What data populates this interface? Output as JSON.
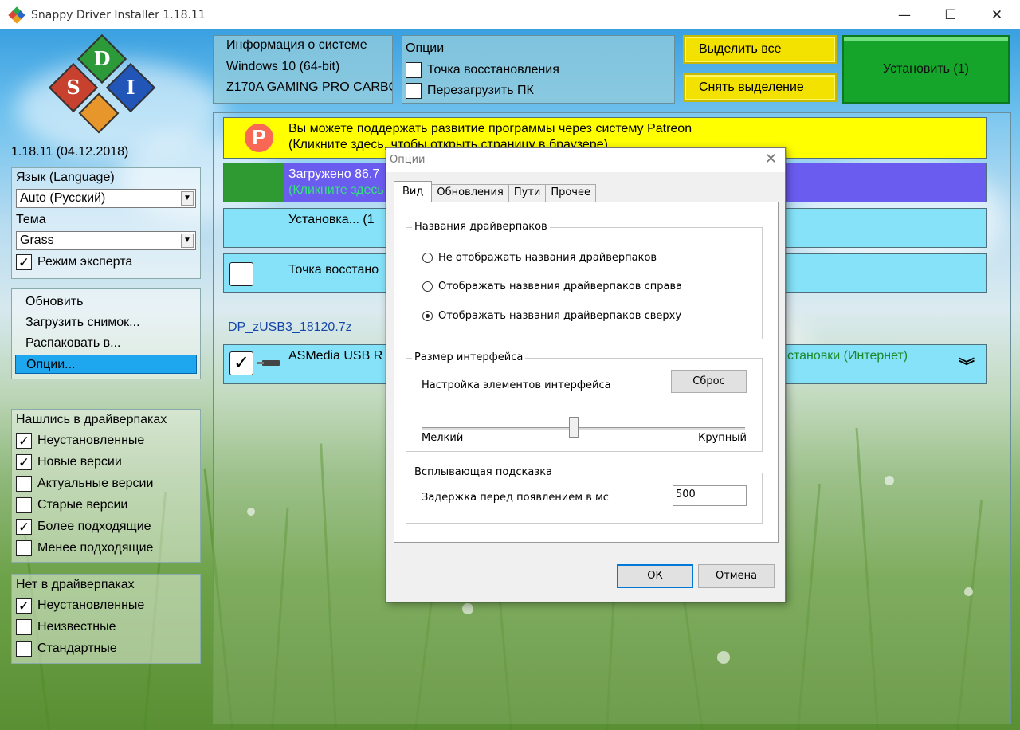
{
  "window": {
    "title": "Snappy Driver Installer 1.18.11",
    "controls": {
      "minimize": "—",
      "maximize": "☐",
      "close": "✕"
    }
  },
  "sidebar": {
    "version": "1.18.11 (04.12.2018)",
    "language_label": "Язык (Language)",
    "language_value": "Auto (Русский)",
    "theme_label": "Тема",
    "theme_value": "Grass",
    "expert_mode": {
      "label": "Режим эксперта",
      "checked": true
    },
    "menu": [
      {
        "label": "Обновить",
        "selected": false
      },
      {
        "label": "Загрузить снимок...",
        "selected": false
      },
      {
        "label": "Распаковать в...",
        "selected": false
      },
      {
        "label": "Опции...",
        "selected": true
      }
    ],
    "found_group": {
      "title": "Нашлись в драйверпаках",
      "items": [
        {
          "label": "Неустановленные",
          "checked": true
        },
        {
          "label": "Новые версии",
          "checked": true
        },
        {
          "label": "Актуальные версии",
          "checked": false
        },
        {
          "label": "Старые версии",
          "checked": false
        },
        {
          "label": "Более подходящие",
          "checked": true
        },
        {
          "label": "Менее подходящие",
          "checked": false
        }
      ]
    },
    "notin_group": {
      "title": "Нет в драйверпаках",
      "items": [
        {
          "label": "Неустановленные",
          "checked": true
        },
        {
          "label": "Неизвестные",
          "checked": false
        },
        {
          "label": "Стандартные",
          "checked": false
        }
      ]
    }
  },
  "system_info": {
    "title": "Информация о системе",
    "os": "Windows 10 (64-bit)",
    "board": "Z170A GAMING PRO CARBON"
  },
  "top_options": {
    "title": "Опции",
    "restore_point": {
      "label": "Точка восстановления",
      "checked": false
    },
    "reboot": {
      "label": "Перезагрузить ПК",
      "checked": false
    }
  },
  "buttons": {
    "select_all": "Выделить все",
    "deselect": "Снять выделение",
    "install": "Установить (1)"
  },
  "list": {
    "patreon_line1": "Вы можете поддержать развитие программы через систему Patreon",
    "patreon_line2": "(Кликните здесь, чтобы открыть страницу в браузере)",
    "loaded_line1": "Загружено 86,7",
    "loaded_line2": "(Кликните здесь",
    "install_line": "Установка... (1",
    "restore_line": "Точка восстано",
    "pack_name": "DP_zUSB3_18120.7z",
    "driver_name": "ASMedia USB R",
    "driver_status": "становки (Интернет)",
    "expand_icon": "chevron-double-down-icon"
  },
  "dialog": {
    "title": "Опции",
    "tabs": [
      {
        "label": "Вид",
        "active": true
      },
      {
        "label": "Обновления",
        "active": false
      },
      {
        "label": "Пути",
        "active": false
      },
      {
        "label": "Прочее",
        "active": false
      }
    ],
    "names_group": {
      "title": "Названия драйверпаков",
      "options": [
        {
          "label": "Не отображать названия драйверпаков",
          "selected": false
        },
        {
          "label": "Отображать названия драйверпаков справа",
          "selected": false
        },
        {
          "label": "Отображать названия драйверпаков сверху",
          "selected": true
        }
      ]
    },
    "size_group": {
      "title": "Размер интерфейса",
      "setting_label": "Настройка элементов интерфейса",
      "reset_button": "Сброс",
      "min_label": "Мелкий",
      "max_label": "Крупный",
      "slider_value_fraction": 0.47
    },
    "tooltip_group": {
      "title": "Всплывающая подсказка",
      "delay_label": "Задержка перед появлением в мс",
      "delay_value": "500"
    },
    "ok_button": "ОК",
    "cancel_button": "Отмена"
  },
  "colors": {
    "accent_yellow": "#f3e200",
    "install_green": "#15a52a",
    "selection_blue": "#1ea7ef",
    "row_cyan": "#85e2f8",
    "loaded_purple": "#6b5cf0",
    "link_blue": "#1646a8"
  }
}
